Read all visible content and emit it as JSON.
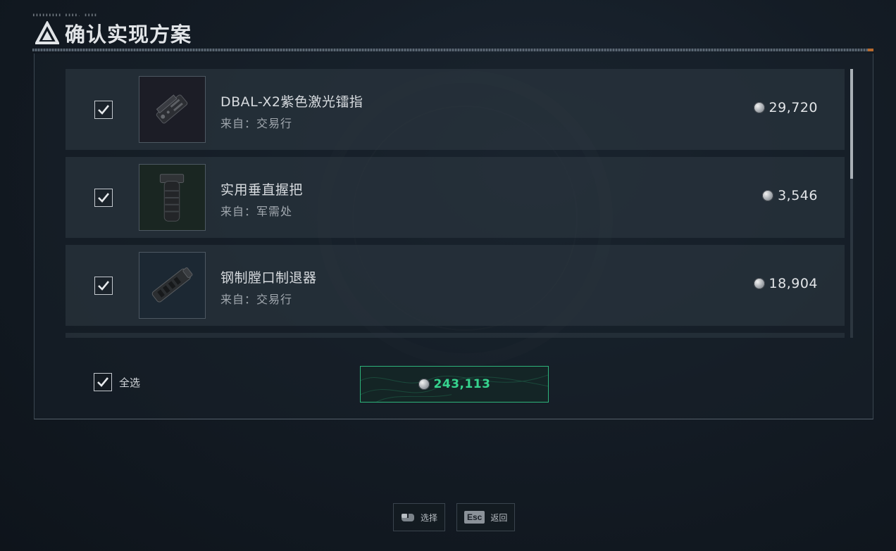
{
  "header": {
    "tag": "▮▮▮▮▮▮▮▮▮ ▮▮▮▮. ▮▮▮▮",
    "title": "确认实现方案"
  },
  "items": [
    {
      "name": "DBAL-X2紫色激光镭指",
      "source": "来自：交易行",
      "price": "29,720",
      "checked": true,
      "icon": "laser-device"
    },
    {
      "name": "实用垂直握把",
      "source": "来自：军需处",
      "price": "3,546",
      "checked": true,
      "icon": "vertical-grip"
    },
    {
      "name": "钢制膛口制退器",
      "source": "来自：交易行",
      "price": "18,904",
      "checked": true,
      "icon": "muzzle-brake"
    }
  ],
  "footer": {
    "select_all_label": "全选",
    "select_all_checked": true,
    "total": "243,113"
  },
  "hints": [
    {
      "key": "mouse-icon",
      "label": "选择"
    },
    {
      "key": "Esc",
      "label": "返回"
    }
  ],
  "colors": {
    "accent_green": "#36d38e",
    "border_green": "#2db37a",
    "title_line_end": "#b86a2e"
  }
}
